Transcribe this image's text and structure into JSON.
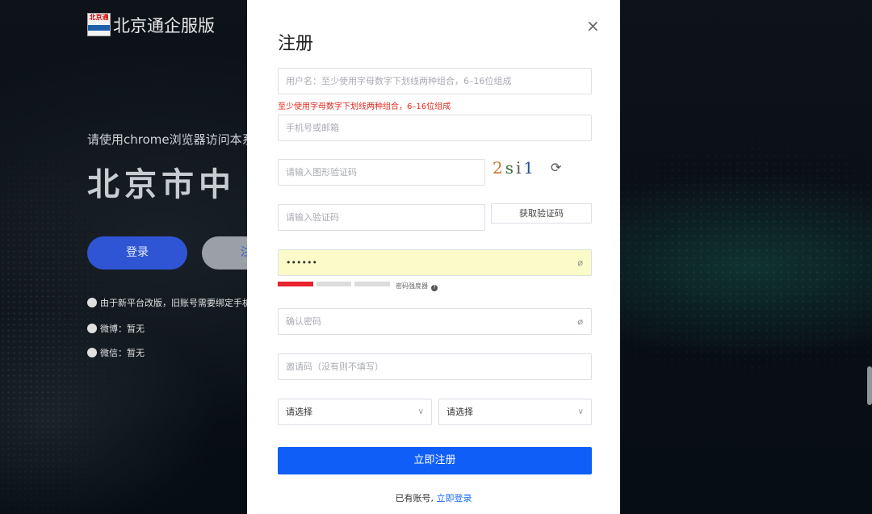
{
  "background": {
    "brand_name": "北京通企服版",
    "logo_text": "北京通",
    "hint": "请使用chrome浏览器访问本系",
    "headline": "北京市中",
    "login_button": "登录",
    "register_button_partial": "注",
    "notice": "由于新平台改版，旧账号需要绑定手机",
    "weibo": "微博：暂无",
    "wechat": "微信：暂无"
  },
  "modal": {
    "title": "注册",
    "close_label": "×",
    "username_placeholder": "用户名：至少使用字母数字下划线两种组合，6–16位组成",
    "username_error": "至少使用字母数字下划线两种组合，6–16位组成",
    "phone_placeholder": "手机号或邮箱",
    "captcha_placeholder": "请输入图形验证码",
    "captcha_chars": [
      "2",
      "s",
      "i",
      "1"
    ],
    "refresh_icon": "⟳",
    "code_placeholder": "请输入验证码",
    "get_code_button": "获取验证码",
    "password_value": "••••••",
    "password_strength_label": "密码强度器",
    "password_strength_level": 1,
    "password_strength_total": 3,
    "confirm_password_placeholder": "确认密码",
    "invite_placeholder": "邀请码（没有则不填写）",
    "select_1": "请选择",
    "select_2": "请选择",
    "submit_button": "立即注册",
    "footer_text": "已有账号,",
    "footer_link": "立即登录"
  },
  "colors": {
    "primary": "#0f5ef7",
    "error": "#e0281e",
    "strength_active": "#e8232c",
    "strength_inactive": "#dcdcdc",
    "autofill": "#fafbc8"
  }
}
